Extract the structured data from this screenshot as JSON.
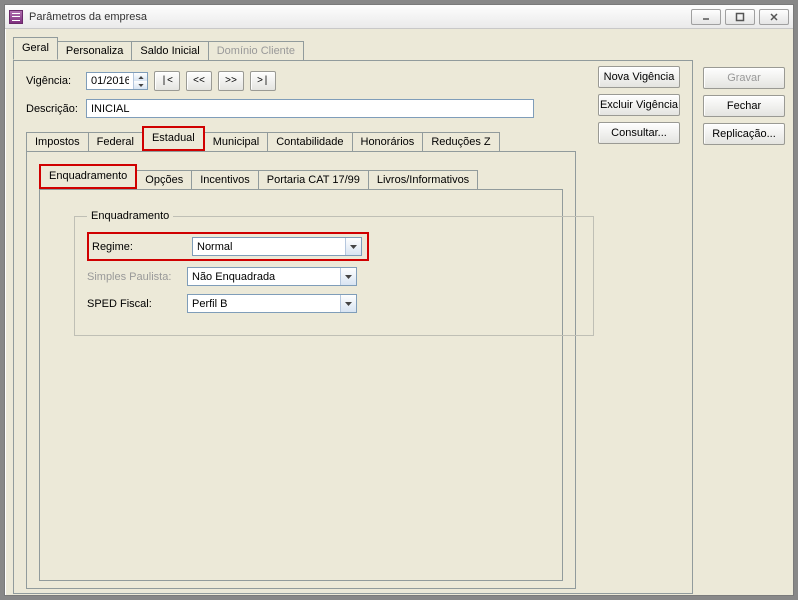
{
  "window": {
    "title": "Parâmetros da empresa"
  },
  "outer_tabs": {
    "geral": "Geral",
    "personaliza": "Personaliza",
    "saldo_inicial": "Saldo Inicial",
    "dominio_cliente": "Domínio Cliente"
  },
  "vigencia": {
    "label": "Vigência:",
    "value": "01/2016"
  },
  "nav": {
    "first": "|<",
    "prev": "<<",
    "next": ">>",
    "last": ">|"
  },
  "descricao": {
    "label": "Descrição:",
    "value": "INICIAL"
  },
  "side_buttons_inner": {
    "nova_vigencia": "Nova Vigência",
    "excluir_vigencia": "Excluir Vigência",
    "consultar": "Consultar..."
  },
  "side_buttons_outer": {
    "gravar": "Gravar",
    "fechar": "Fechar",
    "replicacao": "Replicação..."
  },
  "second_tabs": {
    "impostos": "Impostos",
    "federal": "Federal",
    "estadual": "Estadual",
    "municipal": "Municipal",
    "contabilidade": "Contabilidade",
    "honorarios": "Honorários",
    "reducoes_z": "Reduções Z"
  },
  "third_tabs": {
    "enquadramento": "Enquadramento",
    "opcoes": "Opções",
    "incentivos": "Incentivos",
    "portaria_cat": "Portaria CAT 17/99",
    "livros_informativos": "Livros/Informativos"
  },
  "fieldset": {
    "legend": "Enquadramento",
    "regime_label": "Regime:",
    "regime_value": "Normal",
    "simples_paulista_label": "Simples Paulista:",
    "simples_paulista_value": "Não Enquadrada",
    "sped_fiscal_label": "SPED Fiscal:",
    "sped_fiscal_value": "Perfil B"
  },
  "highlight_color": "#d00000"
}
